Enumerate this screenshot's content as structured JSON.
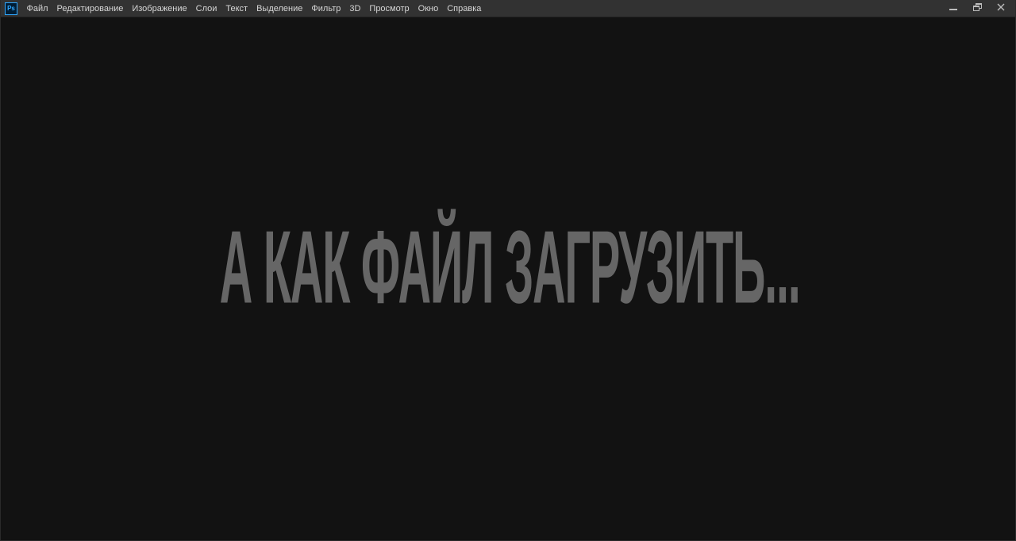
{
  "app": {
    "logo_text": "Ps",
    "accent_color": "#31a8ff"
  },
  "menu": {
    "items": [
      {
        "label": "Файл"
      },
      {
        "label": "Редактирование"
      },
      {
        "label": "Изображение"
      },
      {
        "label": "Слои"
      },
      {
        "label": "Текст"
      },
      {
        "label": "Выделение"
      },
      {
        "label": "Фильтр"
      },
      {
        "label": "3D"
      },
      {
        "label": "Просмотр"
      },
      {
        "label": "Окно"
      },
      {
        "label": "Справка"
      }
    ]
  },
  "window_controls": {
    "icons": [
      "minimize-icon",
      "restore-icon",
      "close-icon"
    ]
  },
  "canvas": {
    "headline": "А КАК ФАЙЛ ЗАГРУЗИТЬ...",
    "text_color": "#666666",
    "background_color": "#121212"
  }
}
